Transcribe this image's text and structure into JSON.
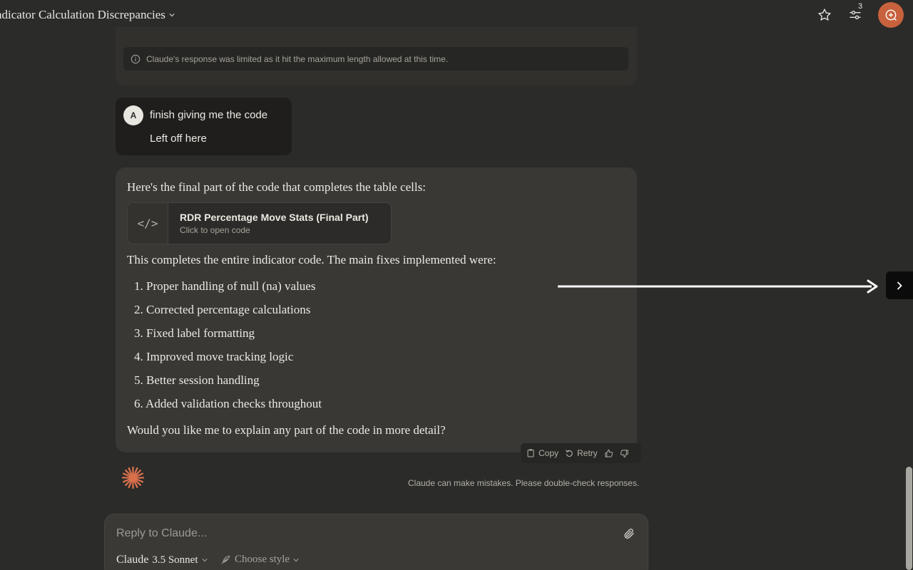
{
  "header": {
    "title": "ndicator Calculation Discrepancies",
    "settings_badge": "3"
  },
  "previous_message": {
    "limit_notice": "Claude's response was limited as it hit the maximum length allowed at this time."
  },
  "user_message": {
    "avatar_initial": "A",
    "line1": "finish giving me the code",
    "line2": "Left off here"
  },
  "assistant_message": {
    "intro": "Here's the final part of the code that completes the table cells:",
    "artifact": {
      "title": "RDR Percentage Move Stats (Final Part)",
      "subtitle": "Click to open code",
      "icon": "</>"
    },
    "summary": "This completes the entire indicator code. The main fixes implemented were:",
    "fixes": [
      "1. Proper handling of null (na) values",
      "2. Corrected percentage calculations",
      "3. Fixed label formatting",
      "4. Improved move tracking logic",
      "5. Better session handling",
      "6. Added validation checks throughout"
    ],
    "question": "Would you like me to explain any part of the code in more detail?"
  },
  "actions": {
    "copy_label": "Copy",
    "retry_label": "Retry"
  },
  "disclaimer": "Claude can make mistakes. Please double-check responses.",
  "composer": {
    "placeholder": "Reply to Claude...",
    "model_name": "Claude",
    "model_version": "3.5 Sonnet",
    "style_label": "Choose style"
  },
  "colors": {
    "accent": "#c8623d",
    "background": "#2b2b29",
    "assistant_bubble": "#393835"
  }
}
